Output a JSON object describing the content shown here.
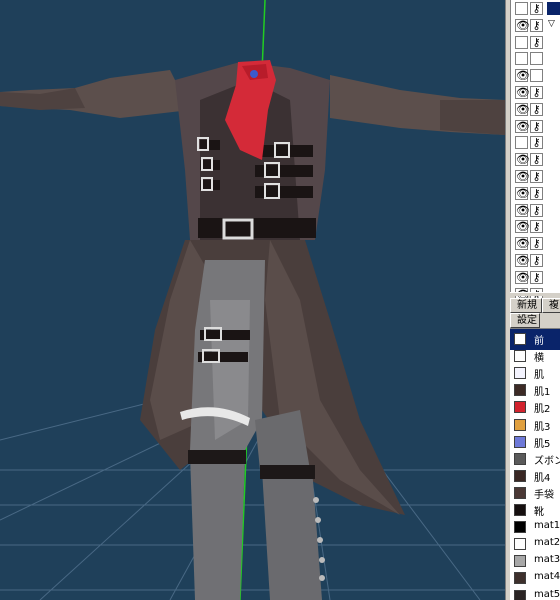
{
  "object_panel": {
    "rows": [
      {
        "visible": false,
        "locked": true,
        "selected": true
      },
      {
        "visible": true,
        "locked": true,
        "expander": true
      },
      {
        "visible": false,
        "locked": true
      },
      {
        "visible": false,
        "locked": false
      },
      {
        "visible": true,
        "locked": false
      },
      {
        "visible": true,
        "locked": true
      },
      {
        "visible": true,
        "locked": true
      },
      {
        "visible": true,
        "locked": true
      },
      {
        "visible": false,
        "locked": true
      },
      {
        "visible": true,
        "locked": true
      },
      {
        "visible": true,
        "locked": true
      },
      {
        "visible": true,
        "locked": true
      },
      {
        "visible": true,
        "locked": true
      },
      {
        "visible": true,
        "locked": true
      },
      {
        "visible": true,
        "locked": true
      },
      {
        "visible": true,
        "locked": true
      },
      {
        "visible": true,
        "locked": true
      },
      {
        "visible": true,
        "locked": true
      }
    ],
    "eye_glyph": "👁",
    "lock_glyph": "⚷",
    "expander_glyph": "▽"
  },
  "buttons": {
    "new_label": "新規",
    "copy_label": "複",
    "settings_label": "設定"
  },
  "materials": [
    {
      "name": "前",
      "color": "#ffffff",
      "selected": true
    },
    {
      "name": "横",
      "color": "#ffffff"
    },
    {
      "name": "肌",
      "color": "#f4f4ff"
    },
    {
      "name": "肌1",
      "color": "#3c2a26"
    },
    {
      "name": "肌2",
      "color": "#d2232e"
    },
    {
      "name": "肌3",
      "color": "#e0a040"
    },
    {
      "name": "肌5",
      "color": "#6e79d8"
    },
    {
      "name": "ズボン",
      "color": "#5a5a5a"
    },
    {
      "name": "肌4",
      "color": "#3a2824"
    },
    {
      "name": "手袋",
      "color": "#4a3835"
    },
    {
      "name": "靴",
      "color": "#161010"
    },
    {
      "name": "mat1",
      "color": "#000000"
    },
    {
      "name": "mat2",
      "color": "#ffffff"
    },
    {
      "name": "mat3",
      "color": "#a8a8a8"
    },
    {
      "name": "mat4",
      "color": "#3e302c"
    },
    {
      "name": "mat5",
      "color": "#2a2424"
    }
  ],
  "viewport": {
    "background": "#1f405a",
    "model": "headless-coat-character"
  }
}
